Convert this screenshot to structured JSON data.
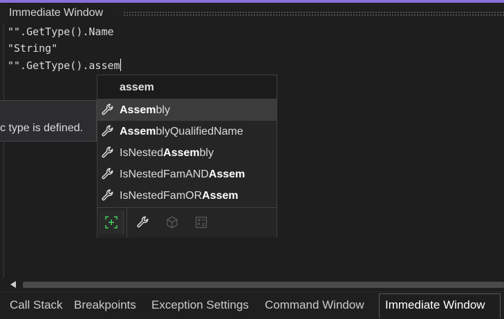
{
  "window": {
    "title": "Immediate Window"
  },
  "editor": {
    "lines": [
      "\"\".GetType().Name",
      "\"String\"",
      "\"\".GetType().assem"
    ]
  },
  "tooltip": {
    "text": "c type is defined."
  },
  "intellisense": {
    "filter_text": "assem",
    "items": [
      {
        "prefix": "",
        "bold": "Assem",
        "suffix": "bly",
        "selected": true,
        "icon": "wrench-icon"
      },
      {
        "prefix": "",
        "bold": "Assem",
        "suffix": "blyQualifiedName",
        "selected": false,
        "icon": "wrench-icon"
      },
      {
        "prefix": "IsNested",
        "bold": "Assem",
        "suffix": "bly",
        "selected": false,
        "icon": "wrench-icon"
      },
      {
        "prefix": "IsNestedFamAND",
        "bold": "Assem",
        "suffix": "",
        "selected": false,
        "icon": "wrench-icon"
      },
      {
        "prefix": "IsNestedFamOR",
        "bold": "Assem",
        "suffix": "",
        "selected": false,
        "icon": "wrench-icon"
      }
    ],
    "filter_icons": [
      "expand-icon",
      "wrench-icon",
      "cube-icon",
      "calculator-icon"
    ]
  },
  "tabs": [
    {
      "label": "Call Stack",
      "active": false
    },
    {
      "label": "Breakpoints",
      "active": false
    },
    {
      "label": "Exception Settings",
      "active": false
    },
    {
      "label": "Command Window",
      "active": false
    },
    {
      "label": "Immediate Window",
      "active": true
    }
  ],
  "colors": {
    "accent": "#8a6fd8",
    "background": "#1e1e1e",
    "popup": "#252526",
    "selection": "#3c3c3c",
    "expand_green": "#3fd15b"
  }
}
